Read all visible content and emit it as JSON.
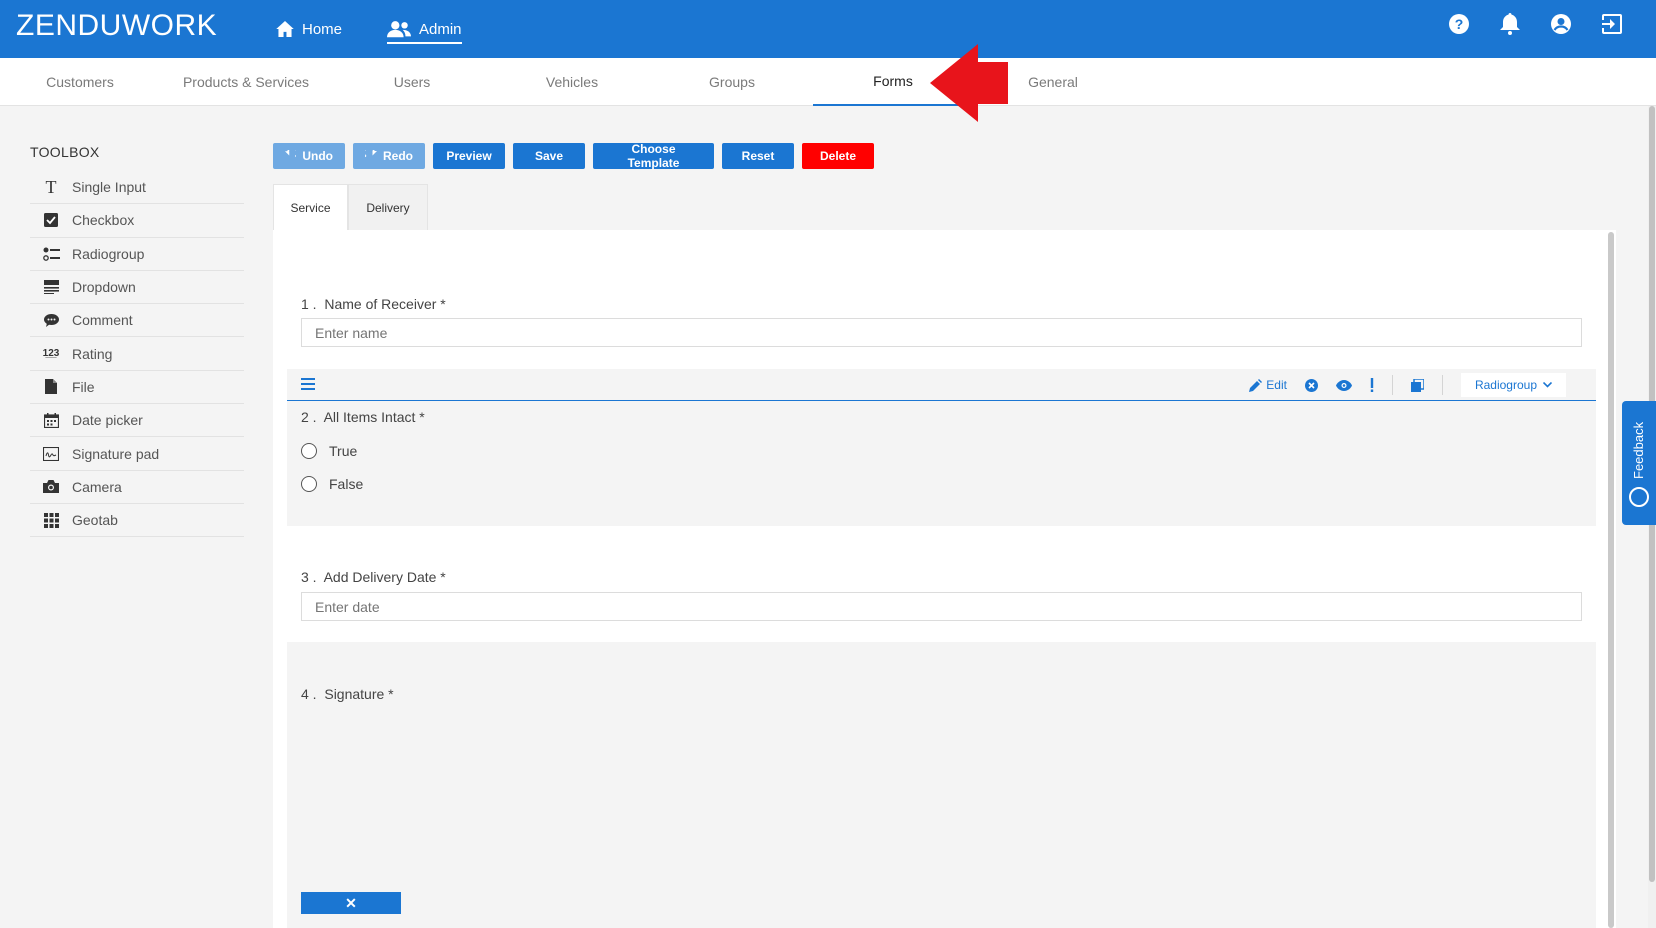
{
  "app": {
    "brand": "ZENDUWORK"
  },
  "topnav": {
    "home": "Home",
    "admin": "Admin"
  },
  "subtabs": [
    "Customers",
    "Products & Services",
    "Users",
    "Vehicles",
    "Groups",
    "Forms",
    "General"
  ],
  "toolbox": {
    "title": "TOOLBOX",
    "items": [
      {
        "label": "Single Input",
        "icon": "text-icon"
      },
      {
        "label": "Checkbox",
        "icon": "checkbox-icon"
      },
      {
        "label": "Radiogroup",
        "icon": "radiogroup-icon"
      },
      {
        "label": "Dropdown",
        "icon": "dropdown-icon"
      },
      {
        "label": "Comment",
        "icon": "comment-icon"
      },
      {
        "label": "Rating",
        "icon": "rating-icon"
      },
      {
        "label": "File",
        "icon": "file-icon"
      },
      {
        "label": "Date picker",
        "icon": "calendar-icon"
      },
      {
        "label": "Signature pad",
        "icon": "signature-icon"
      },
      {
        "label": "Camera",
        "icon": "camera-icon"
      },
      {
        "label": "Geotab",
        "icon": "grid-icon"
      }
    ]
  },
  "actions": {
    "undo": "Undo",
    "redo": "Redo",
    "preview": "Preview",
    "save": "Save",
    "choose_template": "Choose Template",
    "reset": "Reset",
    "delete": "Delete"
  },
  "form_tabs": [
    "Service",
    "Delivery"
  ],
  "questions": {
    "q1": {
      "number": "1 .",
      "title": "Name of Receiver *",
      "placeholder": "Enter name"
    },
    "q2": {
      "number": "2 .",
      "title": "All Items Intact *",
      "options": [
        "True",
        "False"
      ],
      "edit": "Edit",
      "type": "Radiogroup"
    },
    "q3": {
      "number": "3 .",
      "title": "Add Delivery Date *",
      "placeholder": "Enter date"
    },
    "q4": {
      "number": "4 .",
      "title": "Signature *",
      "clear": "✕"
    }
  },
  "feedback": "Feedback",
  "colors": {
    "primary": "#1b76d2",
    "danger": "#ff0000",
    "arrow": "#e8141b"
  }
}
